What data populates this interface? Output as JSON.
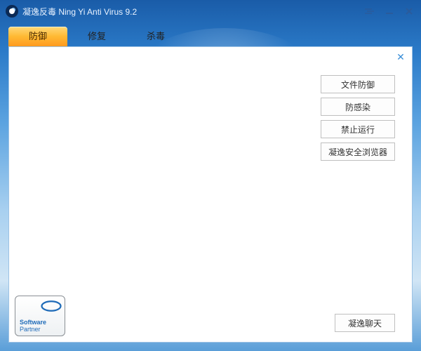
{
  "titlebar": {
    "title": "凝逸反毒 Ning Yi Anti Virus 9.2"
  },
  "tabs": [
    {
      "label": "防御",
      "active": true
    },
    {
      "label": "修复",
      "active": false
    },
    {
      "label": "杀毒",
      "active": false
    }
  ],
  "panel": {
    "options": [
      {
        "label": "文件防御"
      },
      {
        "label": "防感染"
      },
      {
        "label": "禁止运行"
      },
      {
        "label": "凝逸安全浏览器"
      }
    ],
    "chat_button": "凝逸聊天"
  },
  "partner_badge": {
    "line1": "Software",
    "line2": "Partner",
    "brand": "intel"
  }
}
